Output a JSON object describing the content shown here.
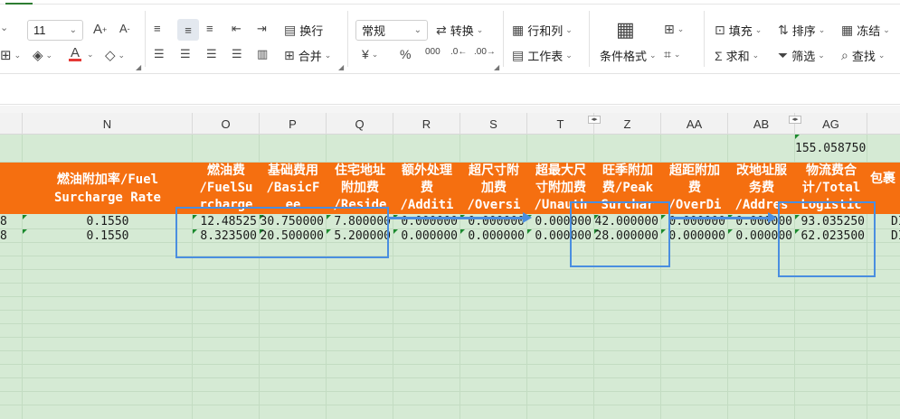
{
  "ribbon": {
    "font_size": "11",
    "number_format": "常规",
    "wrap_text": "换行",
    "merge": "合并",
    "convert": "转换",
    "rows_cols": "行和列",
    "worksheet": "工作表",
    "conditional_format": "条件格式",
    "fill": "填充",
    "sort": "排序",
    "freeze": "冻结",
    "sum": "求和",
    "filter": "筛选",
    "find": "查找",
    "percent_symbol": "%",
    "currency_symbol": "¥",
    "font_color": "#e53935"
  },
  "columns": [
    "N",
    "O",
    "P",
    "Q",
    "R",
    "S",
    "T",
    "Z",
    "AA",
    "AB",
    "AG"
  ],
  "above_header": {
    "ag_value": "155.058750"
  },
  "headers": {
    "N": "燃油附加率/Fuel\nSurcharge Rate",
    "O": "燃油费\n/FuelSu\nrcharge",
    "P": "基础费用\n/BasicF\nee",
    "Q": "住宅地址\n附加费\n/Reside",
    "R": "额外处理\n费\n/Additi",
    "S": "超尺寸附\n加费\n/Oversi",
    "T": "超最大尺\n寸附加费\n/Unauth",
    "Z": "旺季附加\n费/Peak\nSurchar",
    "AA": "超距附加\n费\n/OverDi",
    "AB": "改地址服\n务费\n/Addres",
    "AG": "物流费合\n计/Total\nLogistic",
    "next": "包裹"
  },
  "rows": [
    {
      "left_edge": "8",
      "N": "0.1550",
      "O": "12.48525",
      "P": "30.750000",
      "Q": "7.800000",
      "R": "0.000000",
      "S": "0.000000",
      "T": "0.000000",
      "Z": "42.000000",
      "AA": "0.000000",
      "AB": "0.000000",
      "AG": "93.035250",
      "next": "DI"
    },
    {
      "left_edge": "8",
      "N": "0.1550",
      "O": "8.323500",
      "P": "20.500000",
      "Q": "5.200000",
      "R": "0.000000",
      "S": "0.000000",
      "T": "0.000000",
      "Z": "28.000000",
      "AA": "0.000000",
      "AB": "0.000000",
      "AG": "62.023500",
      "next": "DI"
    }
  ],
  "colors": {
    "header_fill": "#f56f10",
    "grid_fill": "#d5ead4",
    "annotation": "#4a8ee0"
  }
}
